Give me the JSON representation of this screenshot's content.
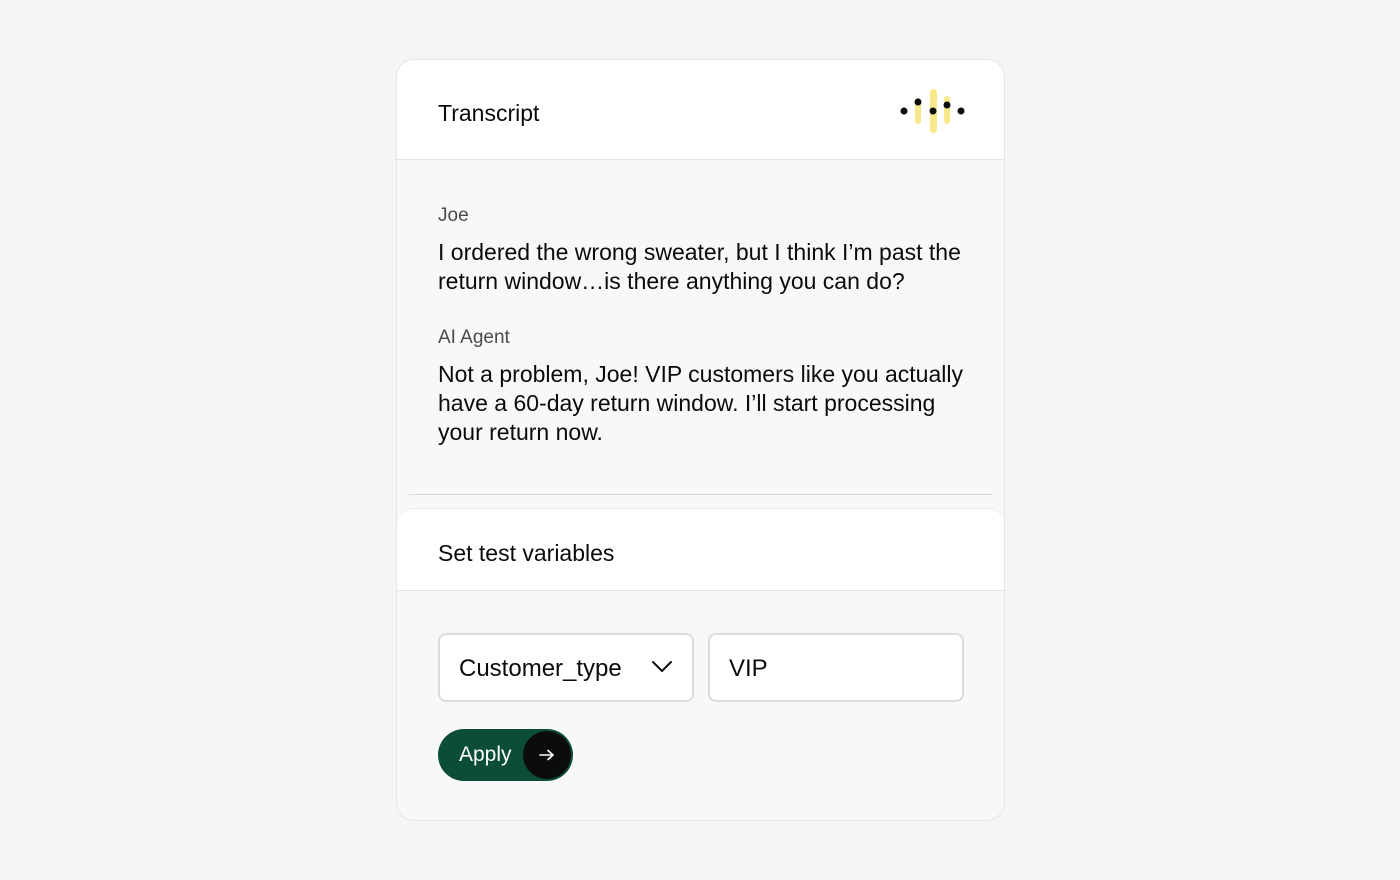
{
  "header": {
    "title": "Transcript",
    "logo_icon": "audio-waveform-icon",
    "accent_color": "#f7e98a"
  },
  "transcript": {
    "messages": [
      {
        "speaker": "Joe",
        "text": "I ordered the wrong sweater, but I think I’m past the return window…is there anything you can do?"
      },
      {
        "speaker": "AI Agent",
        "text": "Not a problem, Joe! VIP customers like you actually have a 60-day return window. I’ll start processing your return now."
      }
    ]
  },
  "test_variables": {
    "title": "Set test variables",
    "variable_select": {
      "selected": "Customer_type",
      "icon": "chevron-down-icon"
    },
    "value_input": {
      "value": "VIP"
    },
    "apply_button": {
      "label": "Apply",
      "icon": "arrow-right-icon",
      "color": "#0b4d36"
    }
  }
}
